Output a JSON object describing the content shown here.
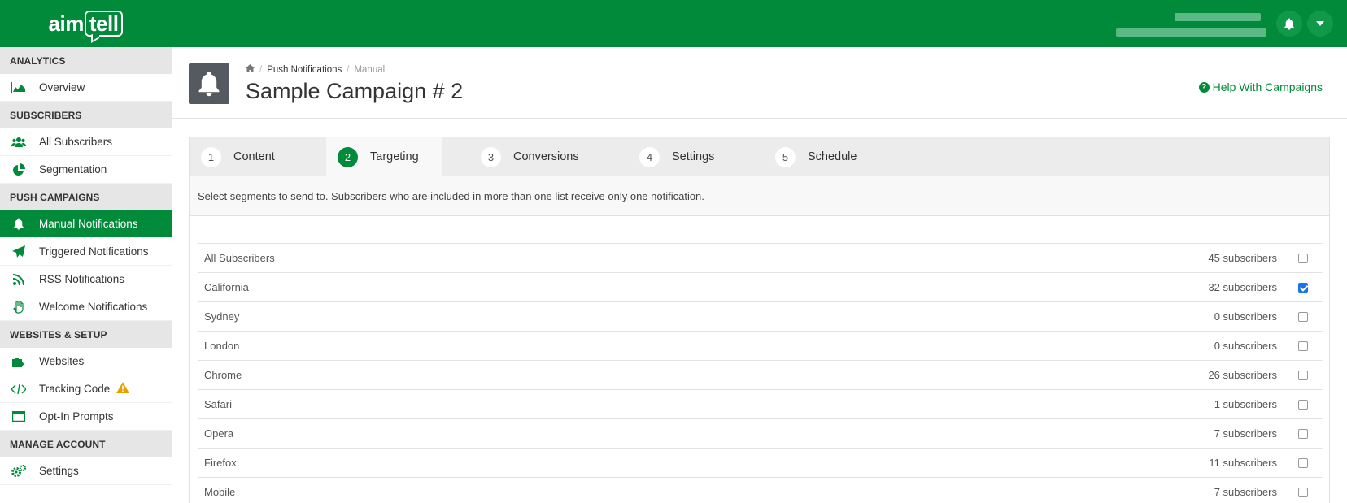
{
  "topbar": {
    "logo_text_1": "aim",
    "logo_text_2": "tell"
  },
  "sidebar": {
    "sections": [
      {
        "title": "ANALYTICS",
        "items": [
          {
            "label": "Overview",
            "icon": "area-chart-icon"
          }
        ]
      },
      {
        "title": "SUBSCRIBERS",
        "items": [
          {
            "label": "All Subscribers",
            "icon": "users-icon"
          },
          {
            "label": "Segmentation",
            "icon": "pie-chart-icon"
          }
        ]
      },
      {
        "title": "PUSH CAMPAIGNS",
        "items": [
          {
            "label": "Manual Notifications",
            "icon": "bell-icon",
            "active": true
          },
          {
            "label": "Triggered Notifications",
            "icon": "paper-plane-icon"
          },
          {
            "label": "RSS Notifications",
            "icon": "rss-icon"
          },
          {
            "label": "Welcome Notifications",
            "icon": "hand-wave-icon"
          }
        ]
      },
      {
        "title": "WEBSITES & SETUP",
        "items": [
          {
            "label": "Websites",
            "icon": "puzzle-icon"
          },
          {
            "label": "Tracking Code",
            "icon": "code-icon",
            "warning": true
          },
          {
            "label": "Opt-In Prompts",
            "icon": "window-icon"
          }
        ]
      },
      {
        "title": "MANAGE ACCOUNT",
        "items": [
          {
            "label": "Settings",
            "icon": "gears-icon"
          }
        ]
      }
    ]
  },
  "header": {
    "breadcrumb": [
      "Push Notifications",
      "Manual"
    ],
    "title": "Sample Campaign # 2",
    "help_label": "Help With Campaigns"
  },
  "tabs": [
    {
      "num": "1",
      "label": "Content"
    },
    {
      "num": "2",
      "label": "Targeting",
      "active": true
    },
    {
      "num": "3",
      "label": "Conversions"
    },
    {
      "num": "4",
      "label": "Settings"
    },
    {
      "num": "5",
      "label": "Schedule"
    }
  ],
  "instructions": "Select segments to send to. Subscribers who are included in more than one list receive only one notification.",
  "segments": [
    {
      "name": "All Subscribers",
      "count": "45 subscribers",
      "checked": false
    },
    {
      "name": "California",
      "count": "32 subscribers",
      "checked": true
    },
    {
      "name": "Sydney",
      "count": "0 subscribers",
      "checked": false
    },
    {
      "name": "London",
      "count": "0 subscribers",
      "checked": false
    },
    {
      "name": "Chrome",
      "count": "26 subscribers",
      "checked": false
    },
    {
      "name": "Safari",
      "count": "1 subscribers",
      "checked": false
    },
    {
      "name": "Opera",
      "count": "7 subscribers",
      "checked": false
    },
    {
      "name": "Firefox",
      "count": "11 subscribers",
      "checked": false
    },
    {
      "name": "Mobile",
      "count": "7 subscribers",
      "checked": false
    }
  ],
  "colors": {
    "brand": "#008a3a",
    "checkbox_on": "#1a73e8",
    "warning": "#e6a100"
  }
}
